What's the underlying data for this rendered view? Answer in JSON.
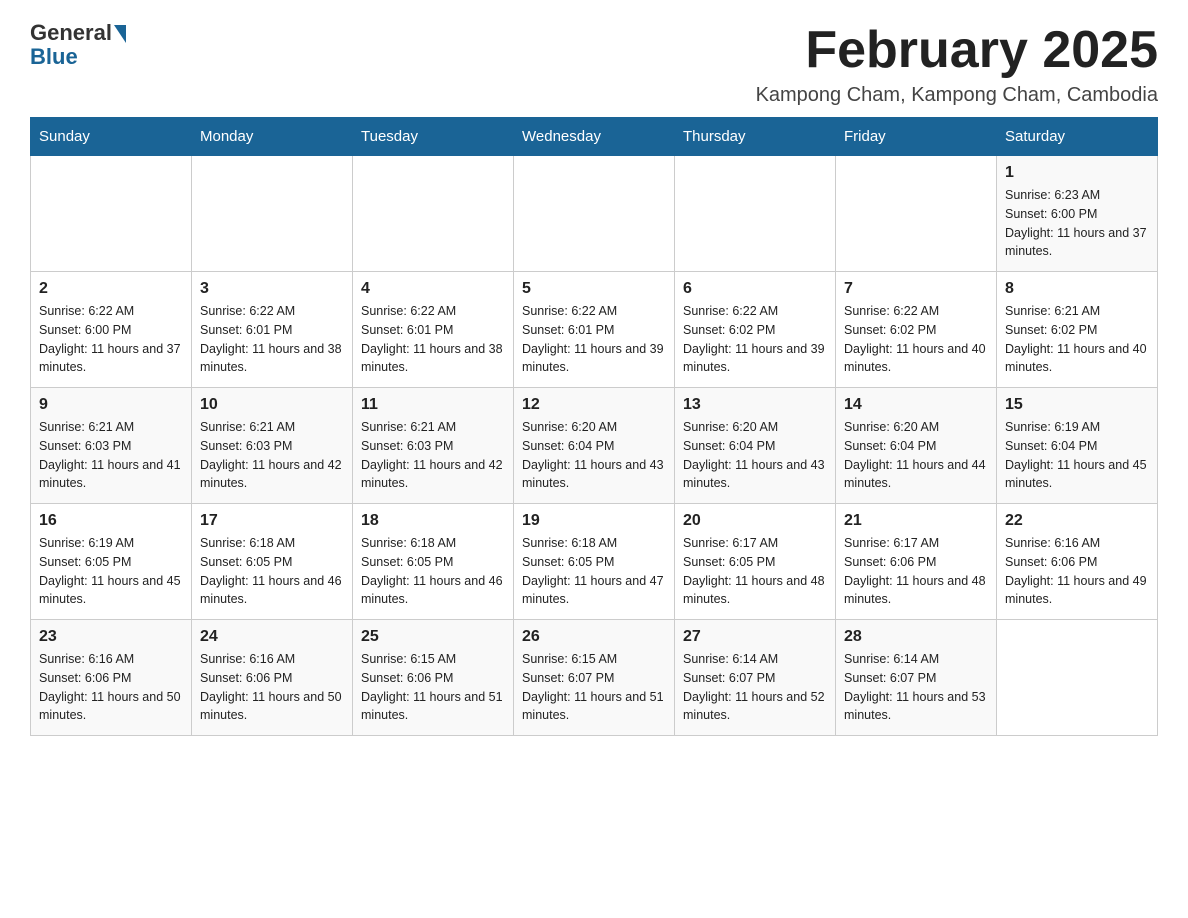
{
  "logo": {
    "general": "General",
    "blue": "Blue"
  },
  "title": "February 2025",
  "location": "Kampong Cham, Kampong Cham, Cambodia",
  "days_of_week": [
    "Sunday",
    "Monday",
    "Tuesday",
    "Wednesday",
    "Thursday",
    "Friday",
    "Saturday"
  ],
  "weeks": [
    [
      {
        "day": "",
        "info": ""
      },
      {
        "day": "",
        "info": ""
      },
      {
        "day": "",
        "info": ""
      },
      {
        "day": "",
        "info": ""
      },
      {
        "day": "",
        "info": ""
      },
      {
        "day": "",
        "info": ""
      },
      {
        "day": "1",
        "info": "Sunrise: 6:23 AM\nSunset: 6:00 PM\nDaylight: 11 hours and 37 minutes."
      }
    ],
    [
      {
        "day": "2",
        "info": "Sunrise: 6:22 AM\nSunset: 6:00 PM\nDaylight: 11 hours and 37 minutes."
      },
      {
        "day": "3",
        "info": "Sunrise: 6:22 AM\nSunset: 6:01 PM\nDaylight: 11 hours and 38 minutes."
      },
      {
        "day": "4",
        "info": "Sunrise: 6:22 AM\nSunset: 6:01 PM\nDaylight: 11 hours and 38 minutes."
      },
      {
        "day": "5",
        "info": "Sunrise: 6:22 AM\nSunset: 6:01 PM\nDaylight: 11 hours and 39 minutes."
      },
      {
        "day": "6",
        "info": "Sunrise: 6:22 AM\nSunset: 6:02 PM\nDaylight: 11 hours and 39 minutes."
      },
      {
        "day": "7",
        "info": "Sunrise: 6:22 AM\nSunset: 6:02 PM\nDaylight: 11 hours and 40 minutes."
      },
      {
        "day": "8",
        "info": "Sunrise: 6:21 AM\nSunset: 6:02 PM\nDaylight: 11 hours and 40 minutes."
      }
    ],
    [
      {
        "day": "9",
        "info": "Sunrise: 6:21 AM\nSunset: 6:03 PM\nDaylight: 11 hours and 41 minutes."
      },
      {
        "day": "10",
        "info": "Sunrise: 6:21 AM\nSunset: 6:03 PM\nDaylight: 11 hours and 42 minutes."
      },
      {
        "day": "11",
        "info": "Sunrise: 6:21 AM\nSunset: 6:03 PM\nDaylight: 11 hours and 42 minutes."
      },
      {
        "day": "12",
        "info": "Sunrise: 6:20 AM\nSunset: 6:04 PM\nDaylight: 11 hours and 43 minutes."
      },
      {
        "day": "13",
        "info": "Sunrise: 6:20 AM\nSunset: 6:04 PM\nDaylight: 11 hours and 43 minutes."
      },
      {
        "day": "14",
        "info": "Sunrise: 6:20 AM\nSunset: 6:04 PM\nDaylight: 11 hours and 44 minutes."
      },
      {
        "day": "15",
        "info": "Sunrise: 6:19 AM\nSunset: 6:04 PM\nDaylight: 11 hours and 45 minutes."
      }
    ],
    [
      {
        "day": "16",
        "info": "Sunrise: 6:19 AM\nSunset: 6:05 PM\nDaylight: 11 hours and 45 minutes."
      },
      {
        "day": "17",
        "info": "Sunrise: 6:18 AM\nSunset: 6:05 PM\nDaylight: 11 hours and 46 minutes."
      },
      {
        "day": "18",
        "info": "Sunrise: 6:18 AM\nSunset: 6:05 PM\nDaylight: 11 hours and 46 minutes."
      },
      {
        "day": "19",
        "info": "Sunrise: 6:18 AM\nSunset: 6:05 PM\nDaylight: 11 hours and 47 minutes."
      },
      {
        "day": "20",
        "info": "Sunrise: 6:17 AM\nSunset: 6:05 PM\nDaylight: 11 hours and 48 minutes."
      },
      {
        "day": "21",
        "info": "Sunrise: 6:17 AM\nSunset: 6:06 PM\nDaylight: 11 hours and 48 minutes."
      },
      {
        "day": "22",
        "info": "Sunrise: 6:16 AM\nSunset: 6:06 PM\nDaylight: 11 hours and 49 minutes."
      }
    ],
    [
      {
        "day": "23",
        "info": "Sunrise: 6:16 AM\nSunset: 6:06 PM\nDaylight: 11 hours and 50 minutes."
      },
      {
        "day": "24",
        "info": "Sunrise: 6:16 AM\nSunset: 6:06 PM\nDaylight: 11 hours and 50 minutes."
      },
      {
        "day": "25",
        "info": "Sunrise: 6:15 AM\nSunset: 6:06 PM\nDaylight: 11 hours and 51 minutes."
      },
      {
        "day": "26",
        "info": "Sunrise: 6:15 AM\nSunset: 6:07 PM\nDaylight: 11 hours and 51 minutes."
      },
      {
        "day": "27",
        "info": "Sunrise: 6:14 AM\nSunset: 6:07 PM\nDaylight: 11 hours and 52 minutes."
      },
      {
        "day": "28",
        "info": "Sunrise: 6:14 AM\nSunset: 6:07 PM\nDaylight: 11 hours and 53 minutes."
      },
      {
        "day": "",
        "info": ""
      }
    ]
  ]
}
